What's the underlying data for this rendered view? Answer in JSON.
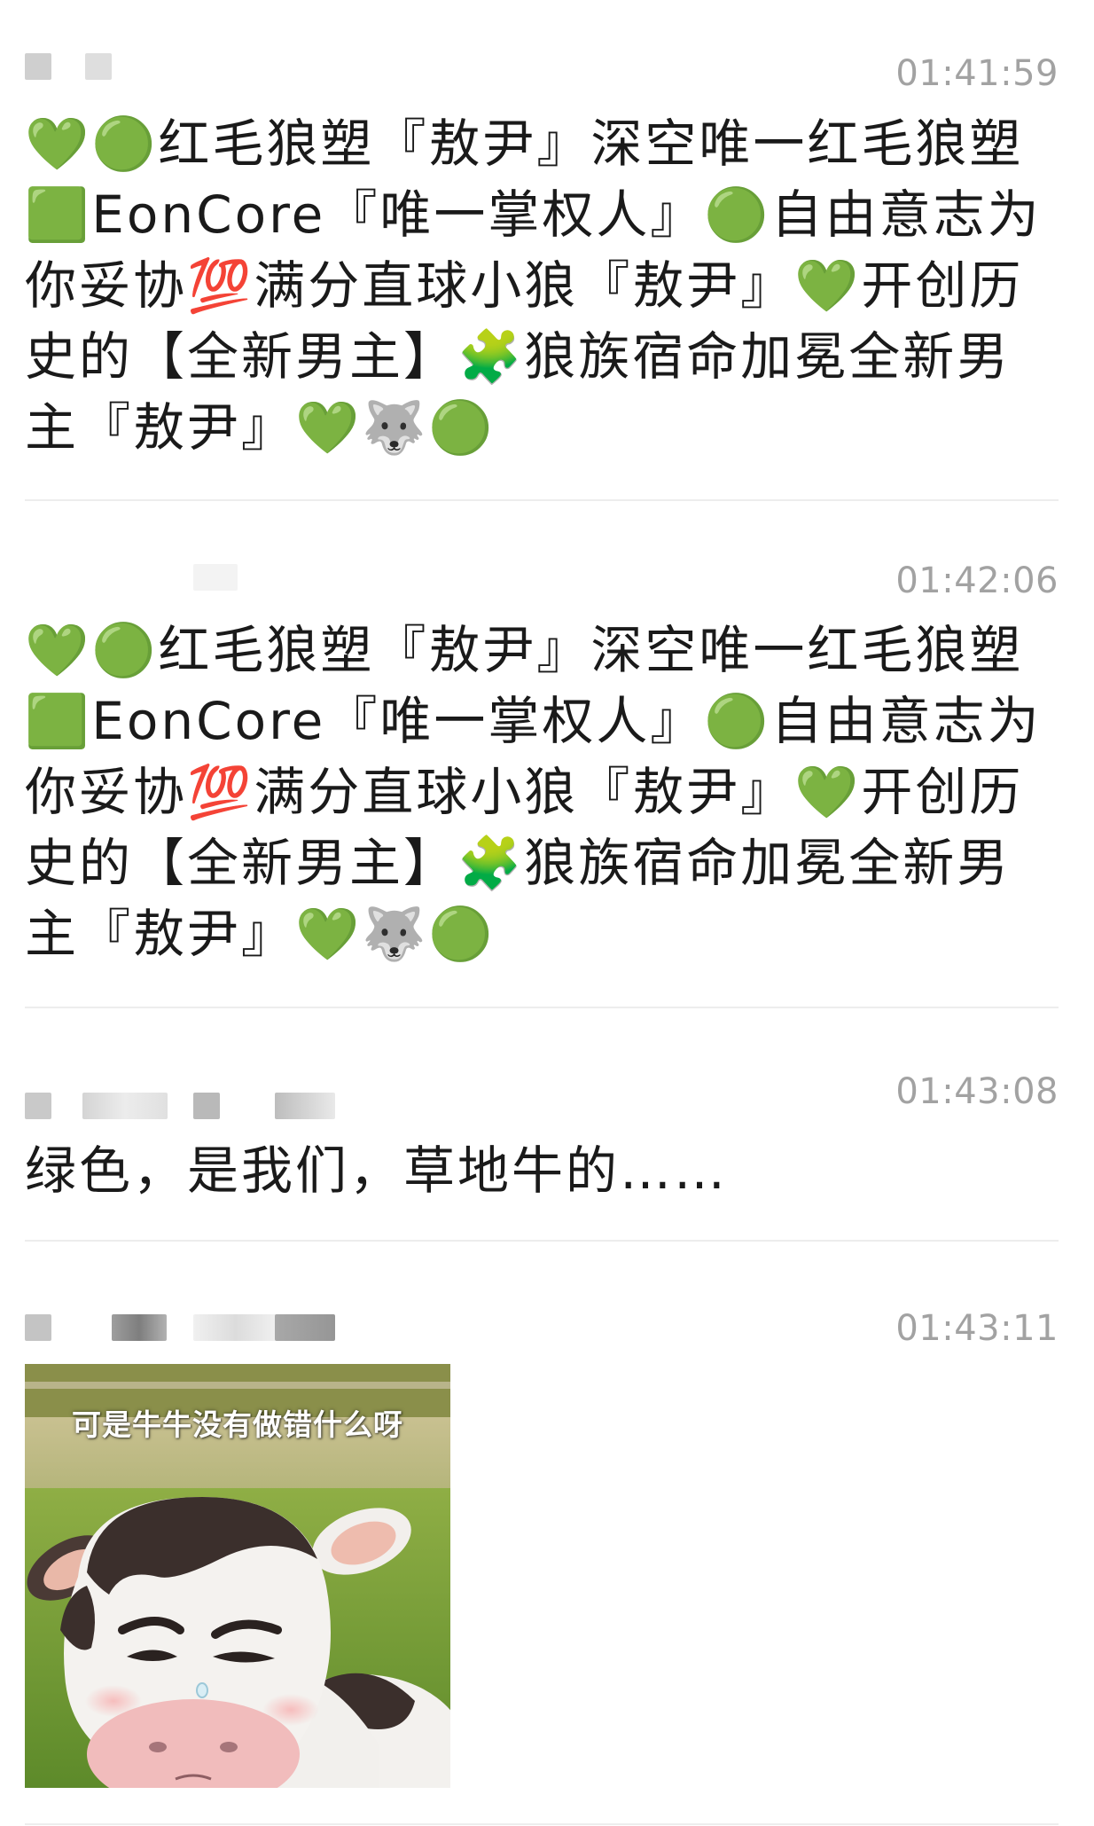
{
  "messages": [
    {
      "time": "01:41:59",
      "text": "💚🟢红毛狼塑『敖尹』深空唯一红毛狼塑🟩EonCore『唯一掌权人』🟢自由意志为你妥协💯满分直球小狼『敖尹』💚开创历史的【全新男主】🧩狼族宿命加冕全新男主『敖尹』💚🐺🟢"
    },
    {
      "time": "01:42:06",
      "text": "💚🟢红毛狼塑『敖尹』深空唯一红毛狼塑🟩EonCore『唯一掌权人』🟢自由意志为你妥协💯满分直球小狼『敖尹』💚开创历史的【全新男主】🧩狼族宿命加冕全新男主『敖尹』💚🐺🟢"
    },
    {
      "time": "01:43:08",
      "text": "绿色，是我们，草地牛的……"
    },
    {
      "time": "01:43:11",
      "image_caption": "可是牛牛没有做错什么呀"
    }
  ]
}
